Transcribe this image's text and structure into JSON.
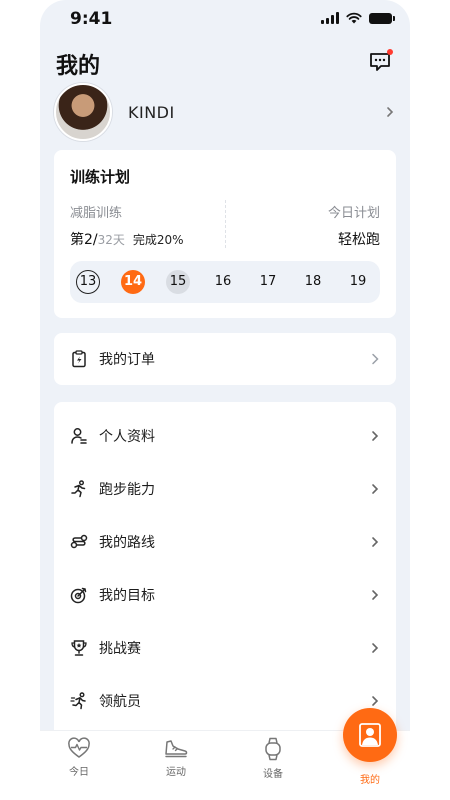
{
  "status_bar": {
    "time": "9:41"
  },
  "header": {
    "title": "我的"
  },
  "profile": {
    "name": "KINDI"
  },
  "plan": {
    "title": "训练计划",
    "type": "减脂训练",
    "week_current": "第2/",
    "week_total": "32天",
    "completion": "完成20%",
    "today_label": "今日计划",
    "today_value": "轻松跑",
    "days": [
      "13",
      "14",
      "15",
      "16",
      "17",
      "18",
      "19"
    ],
    "today_index": 1
  },
  "orders": {
    "label": "我的订单"
  },
  "menu": {
    "items": [
      {
        "label": "个人资料",
        "icon": "profile-icon"
      },
      {
        "label": "跑步能力",
        "icon": "running-icon"
      },
      {
        "label": "我的路线",
        "icon": "route-icon"
      },
      {
        "label": "我的目标",
        "icon": "target-icon"
      },
      {
        "label": "挑战赛",
        "icon": "trophy-icon"
      },
      {
        "label": "领航员",
        "icon": "pacer-icon"
      }
    ]
  },
  "tabs": [
    {
      "label": "今日",
      "icon": "heart-pulse-icon"
    },
    {
      "label": "运动",
      "icon": "sneaker-icon"
    },
    {
      "label": "设备",
      "icon": "watch-icon"
    },
    {
      "label": "我的",
      "icon": "user-icon",
      "active": true
    }
  ],
  "colors": {
    "accent": "#ff6a13",
    "background": "#eef2f8",
    "badge": "#ff3b30"
  }
}
